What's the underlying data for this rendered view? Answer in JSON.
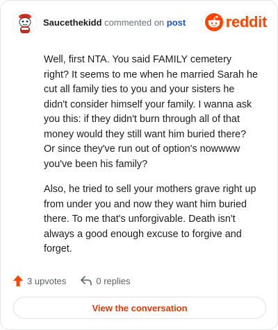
{
  "header": {
    "username": "Saucethekidd",
    "action_text": "commented on",
    "post_link": "post",
    "logo_text": "reddit",
    "logo_icon": "reddit-snoo-icon",
    "avatar_icon": "avatar-icon"
  },
  "comment": {
    "paragraphs": [
      "Well, first NTA. You said FAMILY cemetery right? It seems to me when he married Sarah he cut all family ties to you and your sisters he didn't consider himself your family. I wanna ask you this: if they didn't burn through all of that money would they still want him buried there? Or since they've run out of option's nowwww you've been his family?",
      "Also, he tried to sell your mothers grave right up from under you and now they want him buried there. To me that's unforgivable. Death isn't always a good enough excuse to forgive and forget."
    ]
  },
  "actions": {
    "upvotes": "3 upvotes",
    "replies": "0 replies",
    "upvote_icon": "upvote-arrow-icon",
    "reply_icon": "reply-arrow-icon"
  },
  "cta": {
    "label": "View the conversation"
  },
  "colors": {
    "brand": "#ff4500",
    "link": "#1a56c9",
    "cta": "#d93a00"
  }
}
